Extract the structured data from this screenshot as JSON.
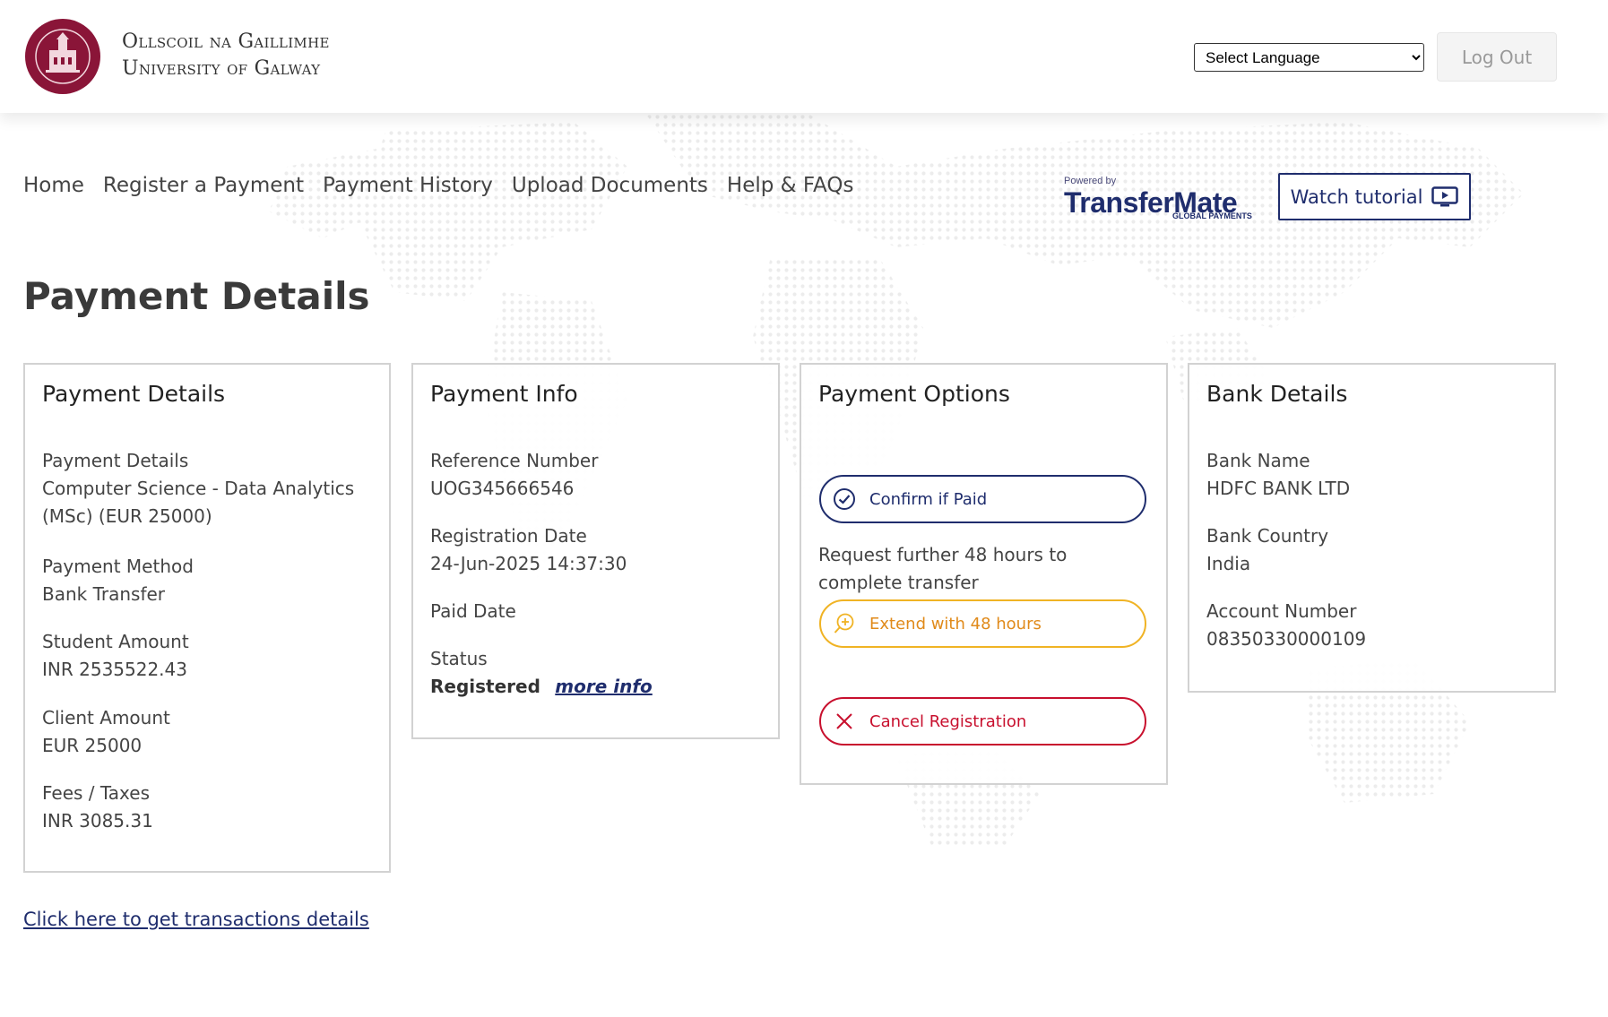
{
  "header": {
    "logo_line1": "Ollscoil na Gaillimhe",
    "logo_line2": "University of Galway",
    "language_select": "Select Language",
    "logout_label": "Log Out"
  },
  "nav": {
    "items": [
      "Home",
      "Register a Payment",
      "Payment History",
      "Upload Documents",
      "Help & FAQs"
    ]
  },
  "powered_by": {
    "small": "Powered by",
    "brand": "TransferMate",
    "sub": "GLOBAL PAYMENTS"
  },
  "tutorial": {
    "label": "Watch tutorial",
    "icon": "play-screen-icon"
  },
  "page_title": "Payment Details",
  "cards": {
    "payment_details": {
      "title": "Payment Details",
      "fields": [
        {
          "label": "Payment Details",
          "value": "Computer Science - Data Analytics (MSc) (EUR 25000)"
        },
        {
          "label": "Payment Method",
          "value": "Bank Transfer"
        },
        {
          "label": "Student Amount",
          "value": "INR 2535522.43"
        },
        {
          "label": "Client Amount",
          "value": "EUR 25000"
        },
        {
          "label": "Fees / Taxes",
          "value": "INR 3085.31"
        }
      ]
    },
    "payment_info": {
      "title": "Payment Info",
      "fields": [
        {
          "label": "Reference Number",
          "value": "UOG345666546"
        },
        {
          "label": "Registration Date",
          "value": "24-Jun-2025 14:37:30"
        },
        {
          "label": "Paid Date",
          "value": ""
        },
        {
          "label": "Status",
          "value": "Registered"
        }
      ],
      "more_info": "more info"
    },
    "payment_options": {
      "title": "Payment Options",
      "confirm_label": "Confirm if Paid",
      "extend_text": "Request further 48 hours to complete transfer",
      "extend_label": "Extend with 48 hours",
      "cancel_label": "Cancel Registration"
    },
    "bank_details": {
      "title": "Bank Details",
      "fields": [
        {
          "label": "Bank Name",
          "value": "HDFC BANK LTD"
        },
        {
          "label": "Bank Country",
          "value": "India"
        },
        {
          "label": "Account Number",
          "value": "08350330000109"
        }
      ]
    }
  },
  "bottom_link": "Click here to get transactions details",
  "colors": {
    "navy": "#1f2d6d",
    "brand_maroon": "#8a1538",
    "extend_amber": "#f0b324",
    "cancel_red": "#c8102e"
  }
}
